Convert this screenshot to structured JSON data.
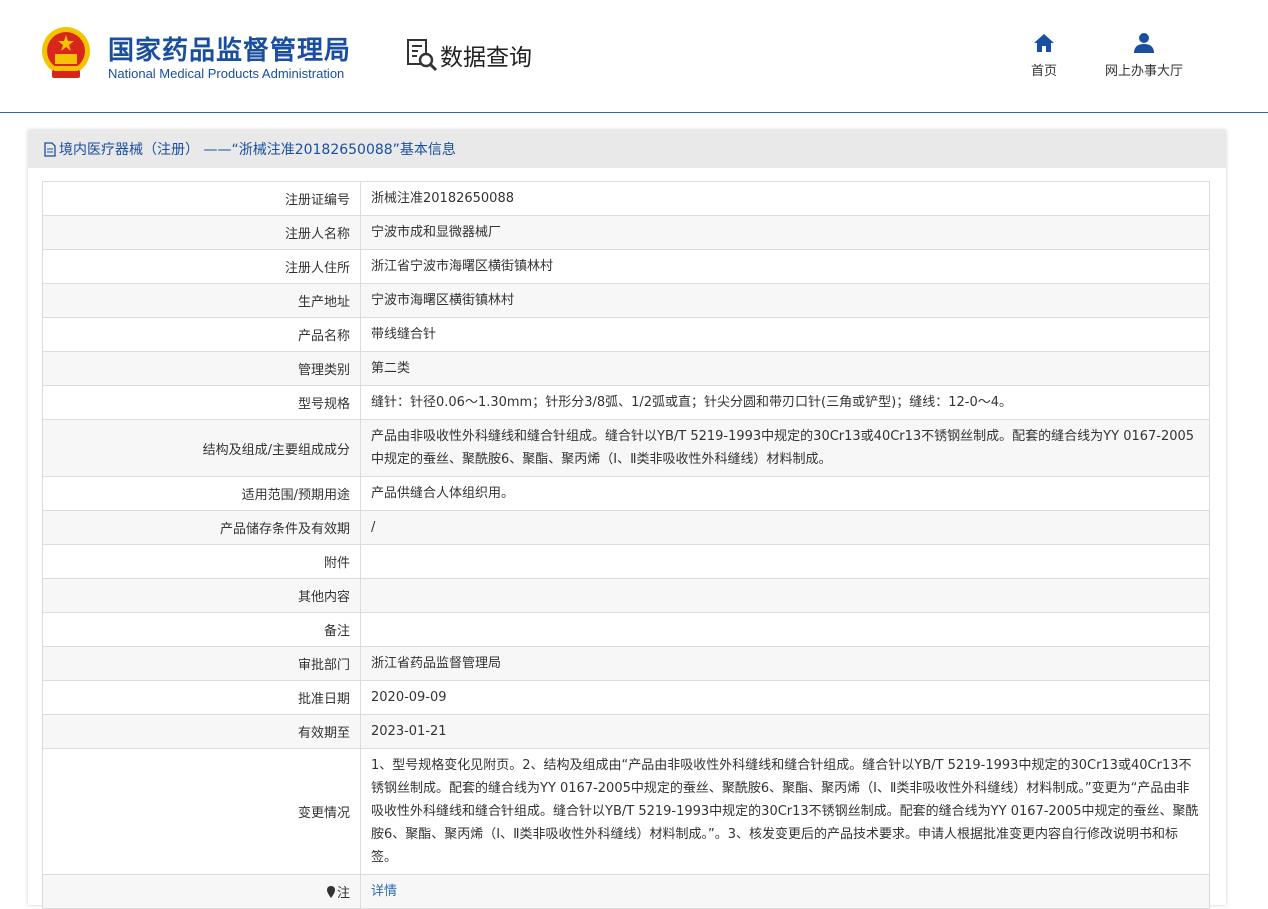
{
  "header": {
    "brand_cn": "国家药品监督管理局",
    "brand_en": "National Medical Products Administration",
    "section_title": "数据查询",
    "nav": [
      {
        "label": "首页",
        "icon": "home-icon"
      },
      {
        "label": "网上办事大厅",
        "icon": "user-icon"
      }
    ]
  },
  "panel": {
    "title": "境内医疗器械（注册） ——“浙械注准20182650088”基本信息",
    "rows": [
      {
        "key": "注册证编号",
        "value": "浙械注准20182650088"
      },
      {
        "key": "注册人名称",
        "value": "宁波市成和显微器械厂"
      },
      {
        "key": "注册人住所",
        "value": "浙江省宁波市海曙区横街镇林村"
      },
      {
        "key": "生产地址",
        "value": "宁波市海曙区横街镇林村"
      },
      {
        "key": "产品名称",
        "value": "带线缝合针"
      },
      {
        "key": "管理类别",
        "value": "第二类"
      },
      {
        "key": "型号规格",
        "value": "缝针：针径0.06～1.30mm；针形分3/8弧、1/2弧或直；针尖分圆和带刃口针(三角或铲型)；缝线：12-0～4。"
      },
      {
        "key": "结构及组成/主要组成成分",
        "value": "产品由非吸收性外科缝线和缝合针组成。缝合针以YB/T 5219-1993中规定的30Cr13或40Cr13不锈钢丝制成。配套的缝合线为YY 0167-2005中规定的蚕丝、聚酰胺6、聚酯、聚丙烯（Ⅰ、Ⅱ类非吸收性外科缝线）材料制成。"
      },
      {
        "key": "适用范围/预期用途",
        "value": "产品供缝合人体组织用。"
      },
      {
        "key": "产品储存条件及有效期",
        "value": "/"
      },
      {
        "key": "附件",
        "value": ""
      },
      {
        "key": "其他内容",
        "value": ""
      },
      {
        "key": "备注",
        "value": ""
      },
      {
        "key": "审批部门",
        "value": "浙江省药品监督管理局"
      },
      {
        "key": "批准日期",
        "value": "2020-09-09"
      },
      {
        "key": "有效期至",
        "value": "2023-01-21"
      },
      {
        "key": "变更情况",
        "value": "1、型号规格变化见附页。2、结构及组成由“产品由非吸收性外科缝线和缝合针组成。缝合针以YB/T 5219-1993中规定的30Cr13或40Cr13不锈钢丝制成。配套的缝合线为YY 0167-2005中规定的蚕丝、聚酰胺6、聚酯、聚丙烯（Ⅰ、Ⅱ类非吸收性外科缝线）材料制成。”变更为“产品由非吸收性外科缝线和缝合针组成。缝合针以YB/T 5219-1993中规定的30Cr13不锈钢丝制成。配套的缝合线为YY 0167-2005中规定的蚕丝、聚酰胺6、聚酯、聚丙烯（Ⅰ、Ⅱ类非吸收性外科缝线）材料制成。”。3、核发变更后的产品技术要求。申请人根据批准变更内容自行修改说明书和标签。"
      }
    ],
    "note_row": {
      "key": "注",
      "value": "详情"
    }
  },
  "colors": {
    "brand_blue": "#1a4fa0",
    "link_blue": "#2b6cb0",
    "emblem_red": "#d9261c",
    "emblem_gold": "#f5c400"
  }
}
